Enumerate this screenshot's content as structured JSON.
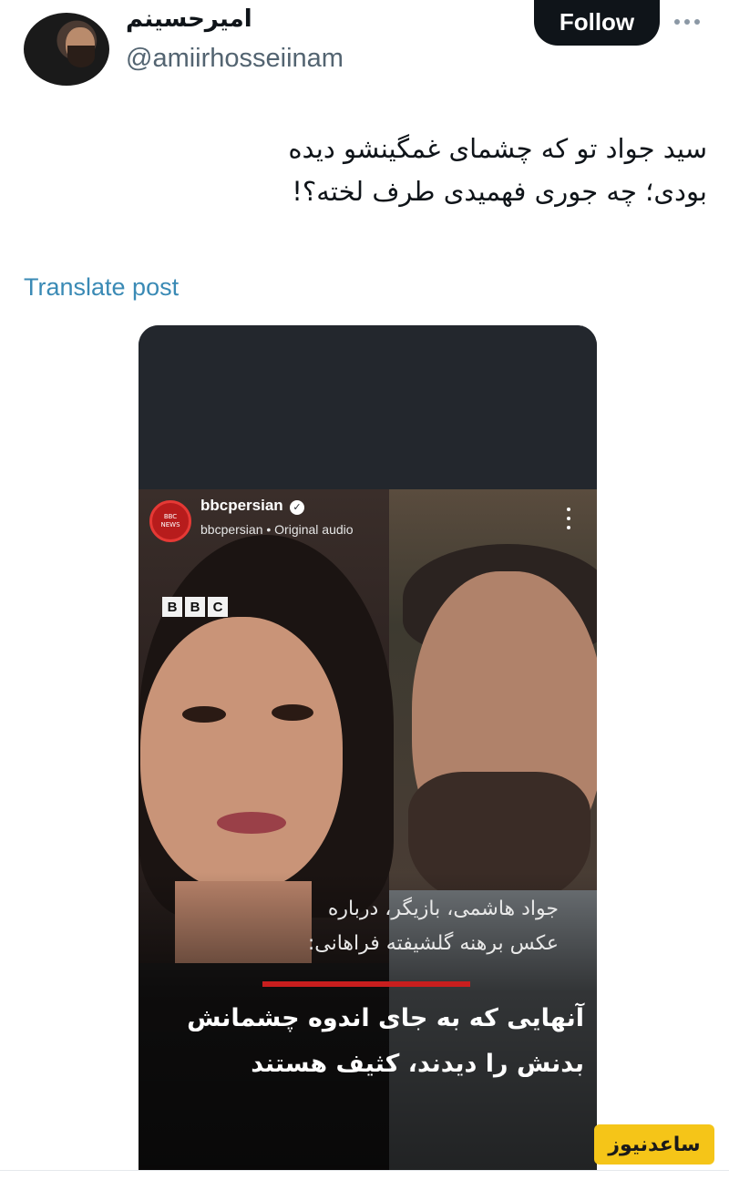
{
  "user": {
    "display_name": "امیرحسینم",
    "handle": "@amiirhosseiinam"
  },
  "actions": {
    "follow_label": "Follow",
    "translate_label": "Translate post"
  },
  "tweet": {
    "text_line1": "سید جواد تو که چشمای غمگینشو دیده",
    "text_line2": "بودی؛ چه جوری فهمیدی طرف لخته؟!"
  },
  "media": {
    "ig_account": "bbcpersian",
    "ig_subtitle": "bbcpersian • Original audio",
    "avatar_badge_top": "BBC",
    "avatar_badge_bottom": "NEWS",
    "bbc_letters": [
      "B",
      "B",
      "C"
    ],
    "caption_small_line1": "جواد هاشمی، بازیگر، درباره",
    "caption_small_line2": "عکس برهنه گلشیفته فراهانی:",
    "caption_big_line1": "آنهایی که به جای اندوه چشمانش",
    "caption_big_line2": "بدنش را دیدند، کثیف هستند"
  },
  "watermark": "ساعدنیوز",
  "colors": {
    "follow_bg": "#0f1419",
    "translate_link": "#3a8ab5",
    "accent_red": "#c81e1e",
    "watermark_bg": "#f5c518"
  }
}
